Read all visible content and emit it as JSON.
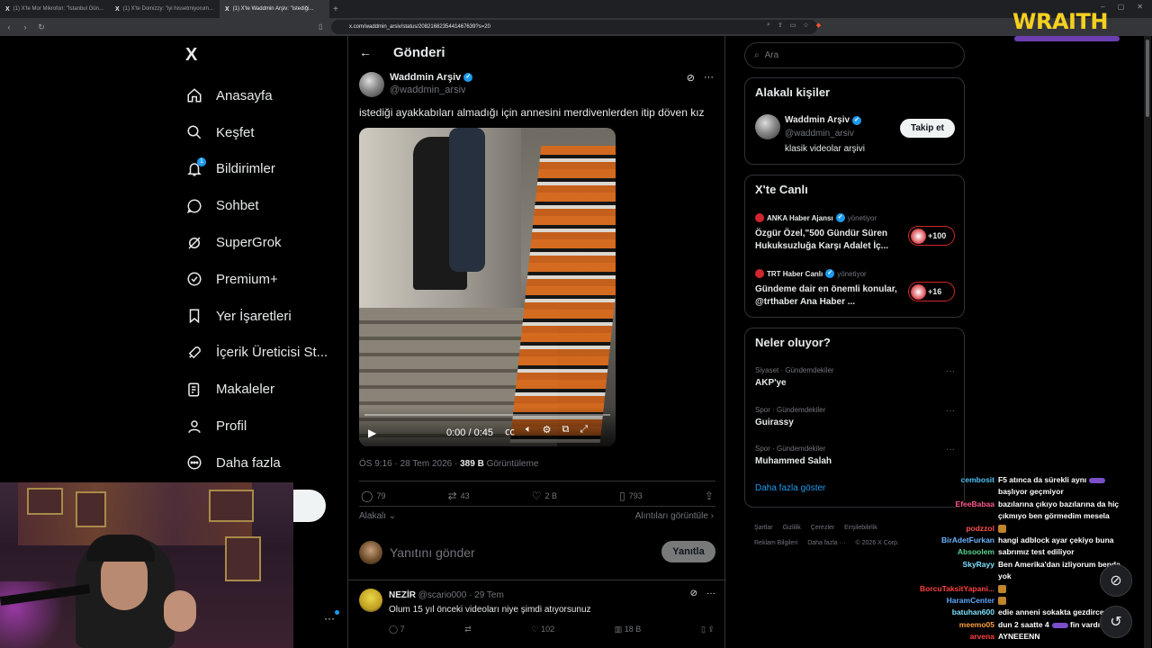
{
  "browser": {
    "tabs": [
      {
        "label": "(1) X'te Mor Mikrofon: \"İstanbul Gün...",
        "active": false
      },
      {
        "label": "(1) X'te Domizzy: \"iyi hissetmiyorum...",
        "active": false
      },
      {
        "label": "(1) X'te Waddmin Arşiv: \"istediği...",
        "active": true
      }
    ],
    "url": "x.com/waddmin_arsiv/status/2082168235441467639?s=20"
  },
  "overlay": {
    "streamer_logo": "WRAITH",
    "accent": "#f5d020"
  },
  "nav": {
    "logo": "X",
    "items": [
      {
        "label": "Anasayfa",
        "icon": "home-icon"
      },
      {
        "label": "Keşfet",
        "icon": "search-icon"
      },
      {
        "label": "Bildirimler",
        "icon": "bell-icon",
        "badge": "1"
      },
      {
        "label": "Sohbet",
        "icon": "chat-icon"
      },
      {
        "label": "SuperGrok",
        "icon": "grok-icon"
      },
      {
        "label": "Premium+",
        "icon": "verified-icon"
      },
      {
        "label": "Yer İşaretleri",
        "icon": "bookmark-icon"
      },
      {
        "label": "İçerik Üreticisi St...",
        "icon": "rocket-icon"
      },
      {
        "label": "Makaleler",
        "icon": "article-icon"
      },
      {
        "label": "Profil",
        "icon": "person-icon"
      },
      {
        "label": "Daha fazla",
        "icon": "more-circle-icon"
      }
    ]
  },
  "post": {
    "header_title": "Gönderi",
    "author_name": "Waddmin Arşiv",
    "author_handle": "@waddmin_arsiv",
    "text": "istediği ayakkabıları almadığı için annesini merdivenlerden itip döven kız",
    "video": {
      "time": "0:00 / 0:45",
      "progress": 0.0
    },
    "timestamp": "ÖS 9:16 · 28 Tem 2026 · ",
    "views": "389 B",
    "views_label": " Görüntüleme",
    "replies": "79",
    "reposts": "43",
    "likes": "2 B",
    "bookmarks": "793",
    "relevance": "Alakalı",
    "quotes_link": "Alıntıları görüntüle",
    "reply_placeholder": "Yanıtını gönder",
    "reply_button": "Yanıtla"
  },
  "comment": {
    "name": "NEZİR",
    "handle": "@scario000 · 29 Tem",
    "text": "Olum 15 yıl önceki videoları niye şimdi atıyorsunuz",
    "replies": "7",
    "reposts": "",
    "likes": "102",
    "views": "18 B"
  },
  "right": {
    "search_placeholder": "Ara",
    "related": {
      "title": "Alakalı kişiler",
      "name": "Waddmin Arşiv",
      "handle": "@waddmin_arsiv",
      "bio": "klasik videolar arşivi",
      "follow": "Takip et"
    },
    "live": {
      "title": "X'te Canlı",
      "items": [
        {
          "host": "ANKA Haber Ajansı",
          "managing": "yönetiyor",
          "title": "Özgür Özel,\"500 Gündür Süren Hukuksuzluğa Karşı Adalet İç...",
          "count": "+100"
        },
        {
          "host": "TRT Haber Canlı",
          "managing": "yönetiyor",
          "title": "Gündeme dair en önemli konular, @trthaber Ana Haber ...",
          "count": "+16"
        }
      ]
    },
    "trends": {
      "title": "Neler oluyor?",
      "items": [
        {
          "category": "Siyaset · Gündemdekiler",
          "name": "AKP'ye"
        },
        {
          "category": "Spor · Gündemdekiler",
          "name": "Guirassy"
        },
        {
          "category": "Spor · Gündemdekiler",
          "name": "Muhammed Salah"
        }
      ],
      "show_more": "Daha fazla göster"
    },
    "footer": [
      "Şartlar",
      "Gizlilik",
      "Çerezler",
      "Erişilebilirlik",
      "Reklam Bilgileri",
      "Daha fazla ···",
      "© 2026 X Corp."
    ]
  },
  "chat": [
    {
      "user": "cembosit",
      "color": "#4fc3f7",
      "text": "F5 atınca da sürekli aynı",
      "line2": "başlıyor geçmiyor"
    },
    {
      "user": "EfeeBabaa",
      "color": "#ff5a8a",
      "text": "bazılarına çıkıyo bazılarına da hiç",
      "line2": "çıkmıyo ben görmedim mesela"
    },
    {
      "user": "podzzol",
      "color": "#ff5050",
      "text": ""
    },
    {
      "user": "BirAdetFurkan",
      "color": "#6cb4ff",
      "text": "hangi adblock ayar çekiyo buna"
    },
    {
      "user": "Absoolem",
      "color": "#58d68d",
      "text": "sabrımız test ediliyor"
    },
    {
      "user": "SkyRayy",
      "color": "#7ee0ff",
      "text": "Ben Amerika'dan izliyorum bende",
      "line2": "yok"
    },
    {
      "user": "BorcuTaksitYapani...",
      "color": "#ff4040",
      "text": ""
    },
    {
      "user": "HaramCenter",
      "color": "#5fa8ff",
      "text": ""
    },
    {
      "user": "batuhan600",
      "color": "#7ee0ff",
      "text": "edie anneni sokakta gezdircem"
    },
    {
      "user": "meemo05",
      "color": "#ff9f40",
      "text": "dun 2 saatte 4",
      "tail": "fin vardı"
    },
    {
      "user": "arvena",
      "color": "#ff4040",
      "text": "AYNEEENN"
    }
  ]
}
